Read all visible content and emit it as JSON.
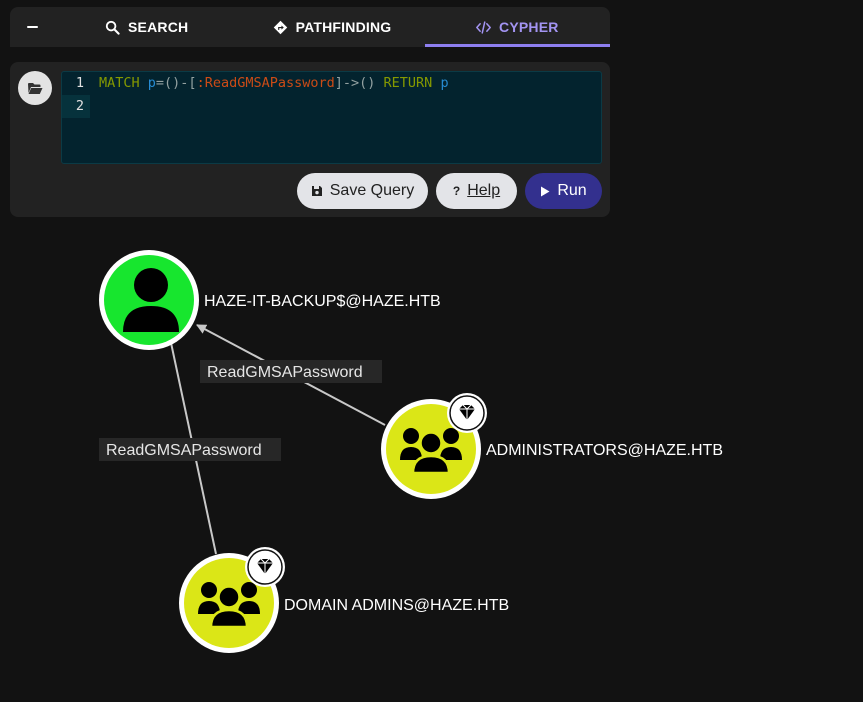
{
  "tabs": {
    "search_label": "SEARCH",
    "pathfinding_label": "PATHFINDING",
    "cypher_label": "CYPHER"
  },
  "editor": {
    "line_numbers": [
      "1",
      "2"
    ],
    "query_tokens": {
      "match": "MATCH",
      "var": "p",
      "pattern_start": "=()-[",
      "rel_type": ":ReadGMSAPassword",
      "pattern_end": "]->()",
      "return_kw": "RETURN",
      "return_var": "p"
    }
  },
  "buttons": {
    "save_label": "Save Query",
    "help_label": "Help",
    "run_label": "Run"
  },
  "graph": {
    "nodes": {
      "haze_it_backup": {
        "label": "HAZE-IT-BACKUP$@HAZE.HTB",
        "kind": "user",
        "color": "#17e62e"
      },
      "administrators": {
        "label": "ADMINISTRATORS@HAZE.HTB",
        "kind": "group",
        "color": "#dbe617",
        "tier_zero": true
      },
      "domain_admins": {
        "label": "DOMAIN ADMINS@HAZE.HTB",
        "kind": "group",
        "color": "#dbe617",
        "tier_zero": true
      }
    },
    "edges": {
      "admins_to_backup": {
        "label": "ReadGMSAPassword"
      },
      "domain_admins_to_backup": {
        "label": "ReadGMSAPassword"
      }
    }
  },
  "colors": {
    "accent": "#8e7ff0",
    "run_button": "#33308e",
    "editor_bg": "#03232e",
    "edge": "#c8c8c8"
  }
}
